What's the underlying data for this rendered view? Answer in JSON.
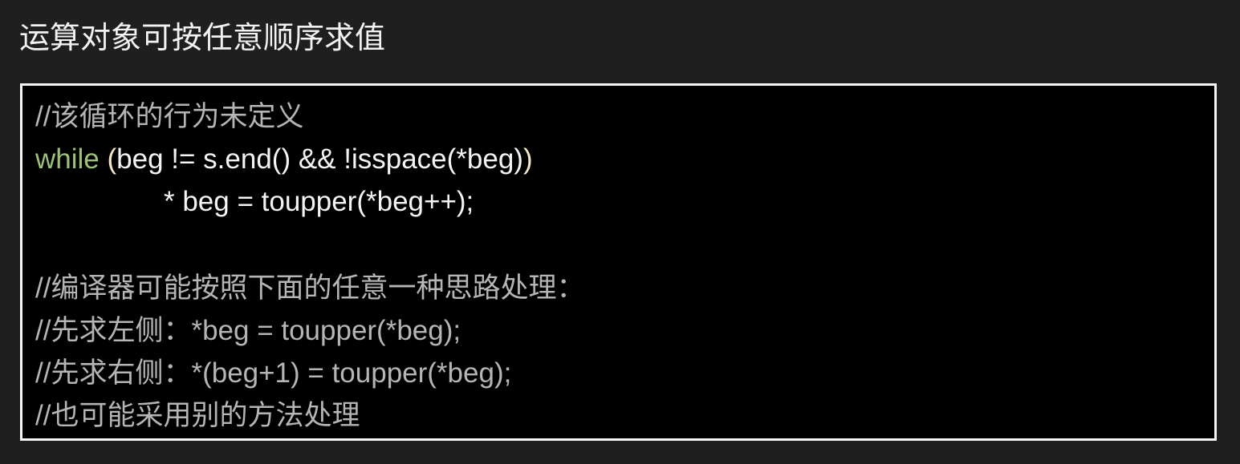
{
  "slide": {
    "title": "运算对象可按任意顺序求值"
  },
  "code": {
    "line1_comment": "//该循环的行为未定义",
    "line2_keyword": "while",
    "line2_space": " ",
    "line2_paren_open": "(",
    "line2_rest": "beg != s.end() && !isspace(*beg)",
    "line2_paren_close": ")",
    "line3_code": "* beg = toupper(*beg++);",
    "line5_comment": "//编译器可能按照下面的任意一种思路处理：",
    "line6_comment": "//先求左侧：*beg = toupper(*beg);",
    "line7_comment": "//先求右侧：*(beg+1) = toupper(*beg);",
    "line8_comment": "//也可能采用别的方法处理"
  },
  "colors": {
    "background": "#1f1f1f",
    "code_background": "#000000",
    "border": "#f5f5f5",
    "keyword": "#9cc27a",
    "comment": "#b5b5b5",
    "code_text": "#f4f4f4"
  }
}
